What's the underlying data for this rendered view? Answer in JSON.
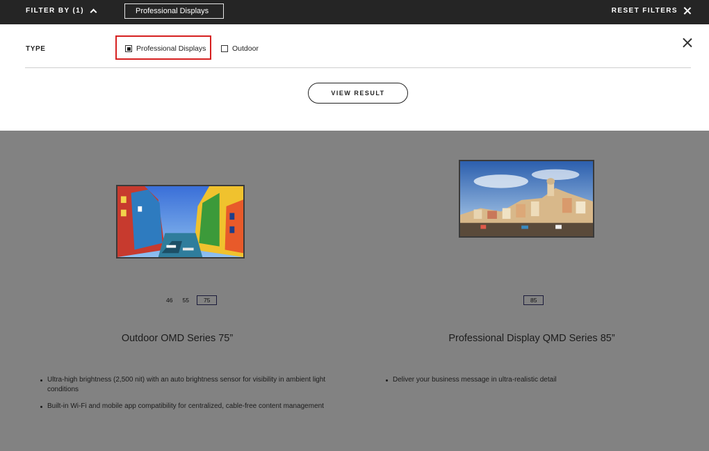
{
  "topbar": {
    "filter_by_label": "FILTER BY (1)",
    "active_chip": "Professional Displays",
    "reset_label": "RESET FILTERS"
  },
  "filter_panel": {
    "type_label": "TYPE",
    "options": [
      {
        "label": "Professional Displays",
        "checked": true
      },
      {
        "label": "Outdoor",
        "checked": false
      }
    ],
    "view_result_label": "VIEW RESULT"
  },
  "products": [
    {
      "title": "Outdoor OMD Series 75”",
      "sizes": [
        "46",
        "55",
        "75"
      ],
      "selected_size": "75",
      "features": [
        "Ultra-high brightness (2,500 nit) with an auto brightness sensor for visibility in ambient light conditions",
        "Built-in Wi-Fi and mobile app compatibility for centralized, cable-free content management"
      ]
    },
    {
      "title": "Professional Display QMD Series 85”",
      "sizes": [
        "85"
      ],
      "selected_size": "85",
      "features": [
        "Deliver your business message in ultra-realistic detail"
      ]
    }
  ],
  "icons": {
    "collapse": "chevron-up-icon",
    "reset": "close-icon",
    "close_panel": "close-icon"
  },
  "colors": {
    "topbar_bg": "#252525",
    "overlay_bg": "#828282",
    "highlight": "#d62020"
  }
}
